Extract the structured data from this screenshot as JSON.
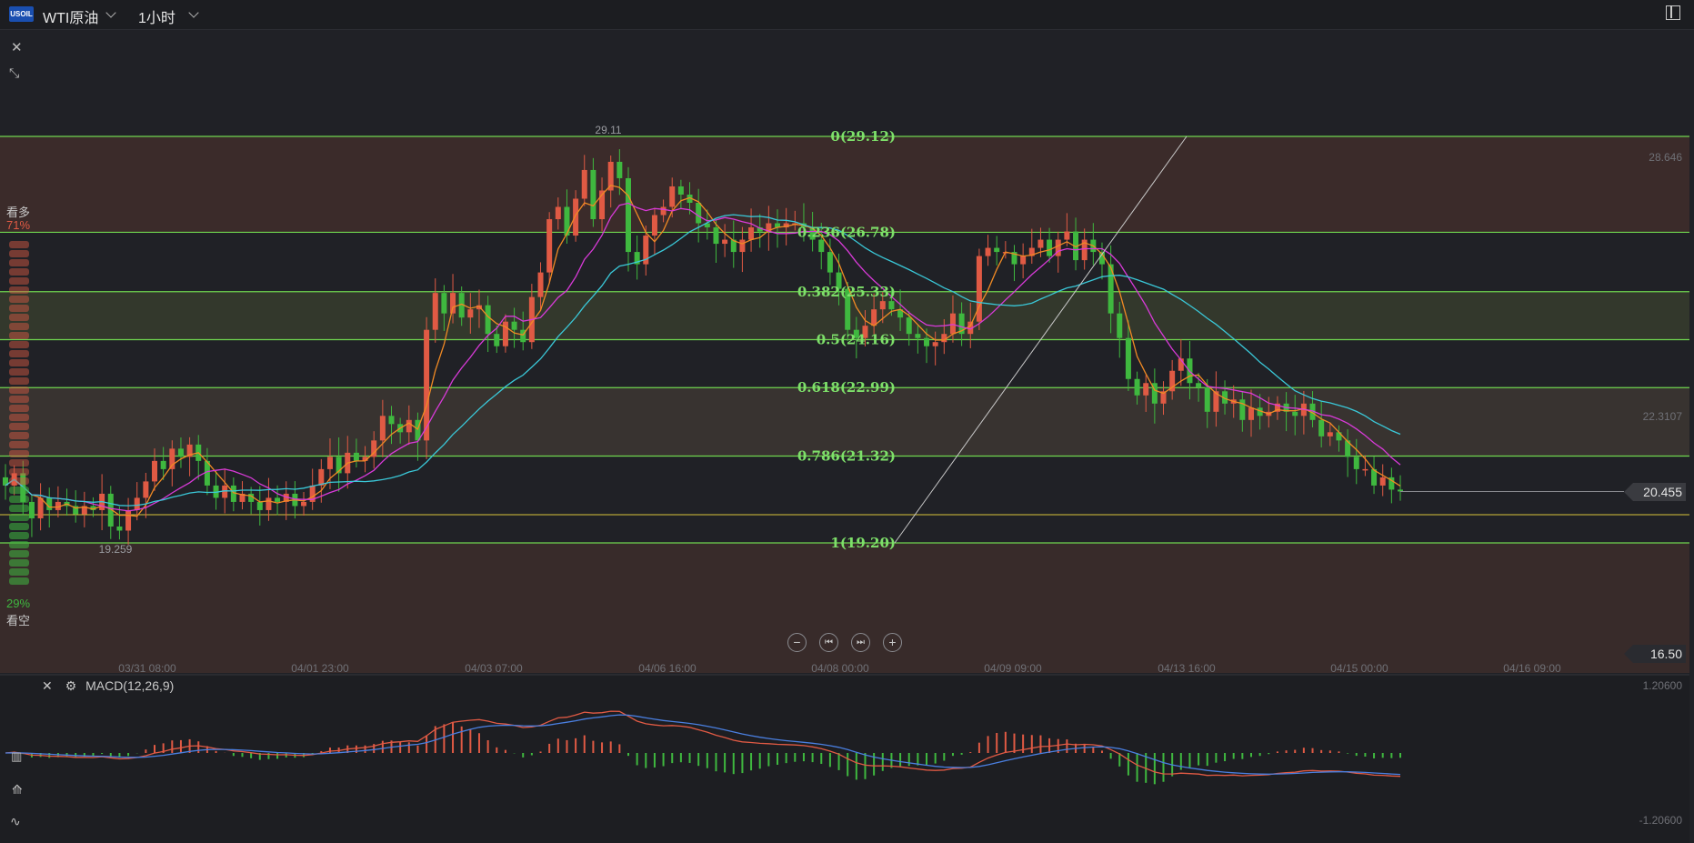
{
  "header": {
    "logo_text": "USOIL",
    "symbol": "WTI原油",
    "timeframe": "1小时"
  },
  "sentiment": {
    "bull_label": "看多",
    "bull_pct": "71%",
    "bear_pct": "29%",
    "bear_label": "看空"
  },
  "price_axis": {
    "top": "28.646",
    "mid": "22.3107",
    "current": "20.455",
    "bottom": "16.50"
  },
  "macd": {
    "title": "MACD(12,26,9)",
    "top": "1.20600",
    "bottom": "-1.20600"
  },
  "colors": {
    "up": "#e05a44",
    "down": "#3fb83f",
    "fib_line": "#6fd64f",
    "fib_text": "#7ee06a",
    "ma_orange": "#f08a24",
    "ma_magenta": "#d83ad8",
    "ma_cyan": "#3ac8d8",
    "macd_dif": "#e05a44",
    "macd_dea": "#4a7fe0"
  },
  "chart_data": {
    "type": "candlestick",
    "symbol": "WTI原油",
    "interval": "1小时",
    "ylim": [
      16.5,
      30.5
    ],
    "x_ticks": [
      "03/31 08:00",
      "04/01 23:00",
      "04/03 07:00",
      "04/06 16:00",
      "04/08 00:00",
      "04/09 09:00",
      "04/13 16:00",
      "04/15 00:00",
      "04/16 09:00"
    ],
    "annotations": {
      "high": "29.11",
      "low": "19.259",
      "last_price": 20.455
    },
    "fibonacci": [
      {
        "label": "0(29.12)",
        "level": 0,
        "price": 29.12
      },
      {
        "label": "0.236(26.78)",
        "level": 0.236,
        "price": 26.78
      },
      {
        "label": "0.382(25.33)",
        "level": 0.382,
        "price": 25.33
      },
      {
        "label": "0.5(24.16)",
        "level": 0.5,
        "price": 24.16
      },
      {
        "label": "0.618(22.99)",
        "level": 0.618,
        "price": 22.99
      },
      {
        "label": "0.786(21.32)",
        "level": 0.786,
        "price": 21.32
      },
      {
        "label": "1(19.20)",
        "level": 1,
        "price": 19.2
      }
    ],
    "close_series": [
      20.6,
      20.9,
      20.2,
      19.8,
      20.3,
      20.0,
      20.2,
      20.1,
      19.9,
      20.1,
      20.0,
      20.4,
      19.6,
      19.5,
      20.0,
      20.3,
      20.7,
      21.2,
      21.0,
      21.5,
      21.3,
      21.6,
      21.2,
      20.6,
      20.3,
      20.6,
      20.2,
      20.4,
      20.2,
      20.0,
      20.3,
      20.2,
      20.4,
      20.1,
      20.2,
      20.6,
      21.0,
      21.3,
      20.9,
      21.4,
      21.2,
      21.3,
      21.7,
      22.3,
      22.1,
      21.9,
      22.2,
      21.7,
      24.4,
      25.3,
      24.8,
      25.3,
      24.7,
      24.9,
      25.0,
      24.3,
      24.0,
      24.6,
      24.4,
      24.1,
      25.2,
      25.8,
      27.1,
      27.4,
      26.7,
      27.6,
      28.3,
      27.1,
      27.8,
      28.5,
      28.1,
      26.3,
      26.0,
      26.7,
      27.2,
      27.4,
      27.9,
      27.7,
      27.5,
      27.0,
      26.9,
      26.5,
      26.6,
      26.3,
      26.6,
      26.9,
      26.8,
      27.0,
      26.9,
      27.0,
      27.0,
      26.9,
      26.6,
      26.3,
      25.8,
      25.4,
      24.4,
      24.2,
      24.5,
      24.9,
      25.1,
      24.9,
      24.7,
      24.3,
      24.2,
      24.0,
      24.1,
      24.3,
      24.8,
      24.3,
      24.6,
      26.2,
      26.4,
      26.3,
      26.3,
      26.0,
      26.2,
      26.4,
      26.6,
      26.2,
      26.6,
      26.8,
      26.1,
      26.6,
      26.3,
      26.0,
      24.8,
      24.2,
      23.2,
      22.8,
      23.1,
      22.6,
      22.9,
      23.4,
      23.7,
      23.1,
      23.0,
      22.4,
      22.9,
      22.6,
      22.7,
      22.2,
      22.5,
      22.3,
      22.4,
      22.6,
      22.4,
      22.3,
      22.6,
      22.2,
      21.8,
      21.9,
      21.7,
      21.3,
      21.0,
      21.0,
      20.6,
      20.8,
      20.5,
      20.455
    ]
  },
  "macd_data": {
    "hist_note": "MACD histogram tracks dif-dea",
    "ylim": [
      -1.206,
      1.206
    ]
  }
}
